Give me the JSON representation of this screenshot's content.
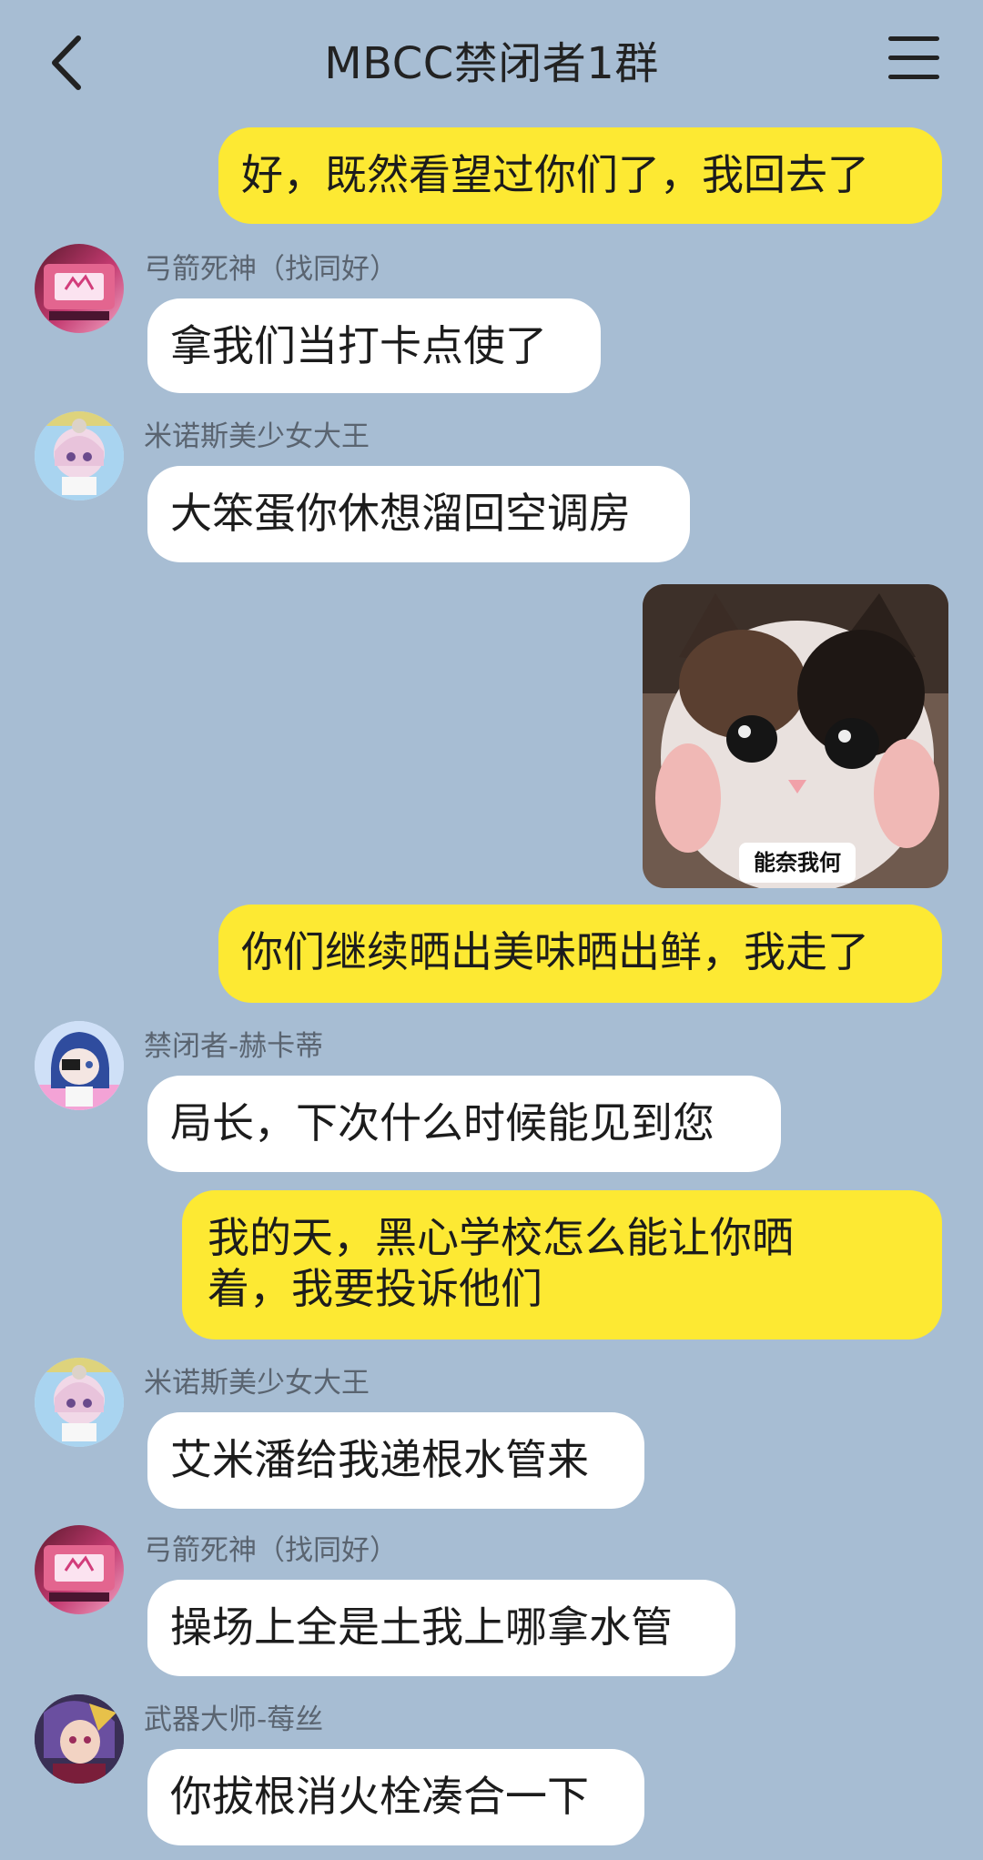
{
  "header": {
    "title": "MBCC禁闭者1群",
    "back_icon": "chevron-left-icon",
    "menu_icon": "hamburger-menu-icon"
  },
  "messages": [
    {
      "side": "right",
      "text": "好，既然看望过你们了，我回去了"
    },
    {
      "side": "left",
      "sender": "弓箭死神（找同好）",
      "text": "拿我们当打卡点使了"
    },
    {
      "side": "left",
      "sender": "米诺斯美少女大王",
      "text": "大笨蛋你休想溜回空调房"
    },
    {
      "side": "right",
      "type": "sticker",
      "caption": "能奈我何"
    },
    {
      "side": "right",
      "text": "你们继续晒出美味晒出鲜，我走了"
    },
    {
      "side": "left",
      "sender": "禁闭者-赫卡蒂",
      "text": "局长，下次什么时候能见到您"
    },
    {
      "side": "right",
      "text_line1": "我的天，黑心学校怎么能让你晒",
      "text_line2": "着，我要投诉他们"
    },
    {
      "side": "left",
      "sender": "米诺斯美少女大王",
      "text": "艾米潘给我递根水管来"
    },
    {
      "side": "left",
      "sender": "弓箭死神（找同好）",
      "text": "操场上全是土我上哪拿水管"
    },
    {
      "side": "left",
      "sender": "武器大师-莓丝",
      "text": "你拔根消火栓凑合一下"
    }
  ],
  "colors": {
    "background": "#a7bdd3",
    "outgoing_bubble": "#fde933",
    "incoming_bubble": "#ffffff"
  }
}
